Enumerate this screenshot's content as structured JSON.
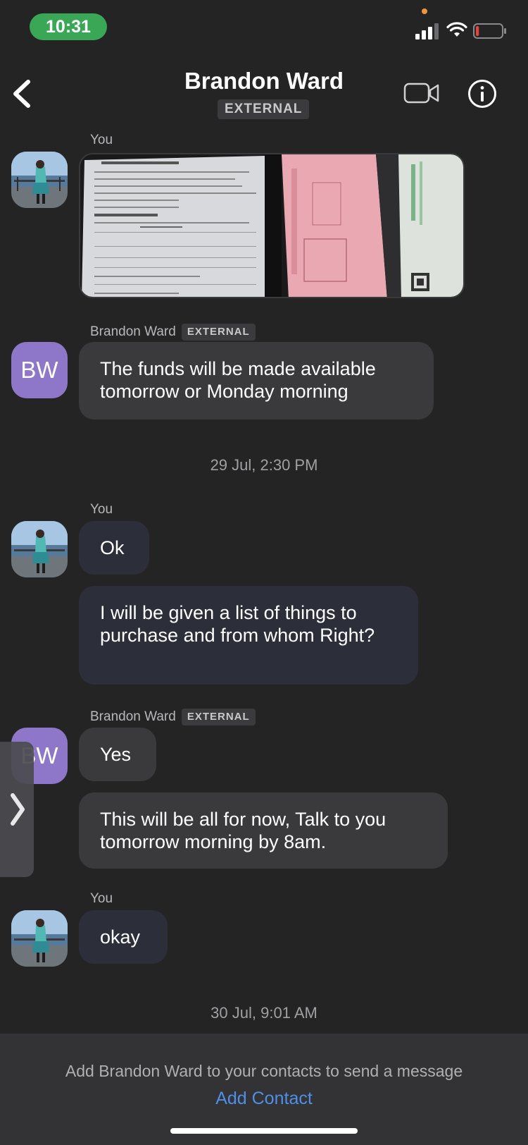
{
  "status_bar": {
    "time": "10:31",
    "accent_time_bg": "#3aa757",
    "battery_level_fraction": 0.12
  },
  "header": {
    "back_icon": "chevron-left-icon",
    "title": "Brandon Ward",
    "badge": "EXTERNAL",
    "video_icon": "video-camera-icon",
    "info_icon": "info-circle-icon"
  },
  "messages": {
    "m1": {
      "sender": "You",
      "type": "image"
    },
    "m2": {
      "sender": "Brandon Ward",
      "badge": "EXTERNAL",
      "avatar_initials": "BW",
      "text": "The funds will be made available tomorrow or Monday morning"
    },
    "sep1": "29 Jul, 2:30 PM",
    "m3": {
      "sender": "You",
      "text1": "Ok",
      "text2": "I will be given a list of things to purchase and from whom Right?"
    },
    "m4": {
      "sender": "Brandon Ward",
      "badge": "EXTERNAL",
      "avatar_initials": "BW",
      "text1": "Yes",
      "text2": "This will be all for now, Talk to you tomorrow morning by 8am."
    },
    "m5": {
      "sender": "You",
      "text": "okay"
    },
    "sep2": "30 Jul, 9:01 AM"
  },
  "footer": {
    "notice": "Add Brandon Ward to your contacts to send a message",
    "action": "Add Contact",
    "action_color": "#4f8fe6"
  },
  "colors": {
    "background": "#242425",
    "avatar_bw": "#8e76c8",
    "bubble_incoming": "#3a3a3c",
    "bubble_outgoing": "#2c2f3a"
  }
}
